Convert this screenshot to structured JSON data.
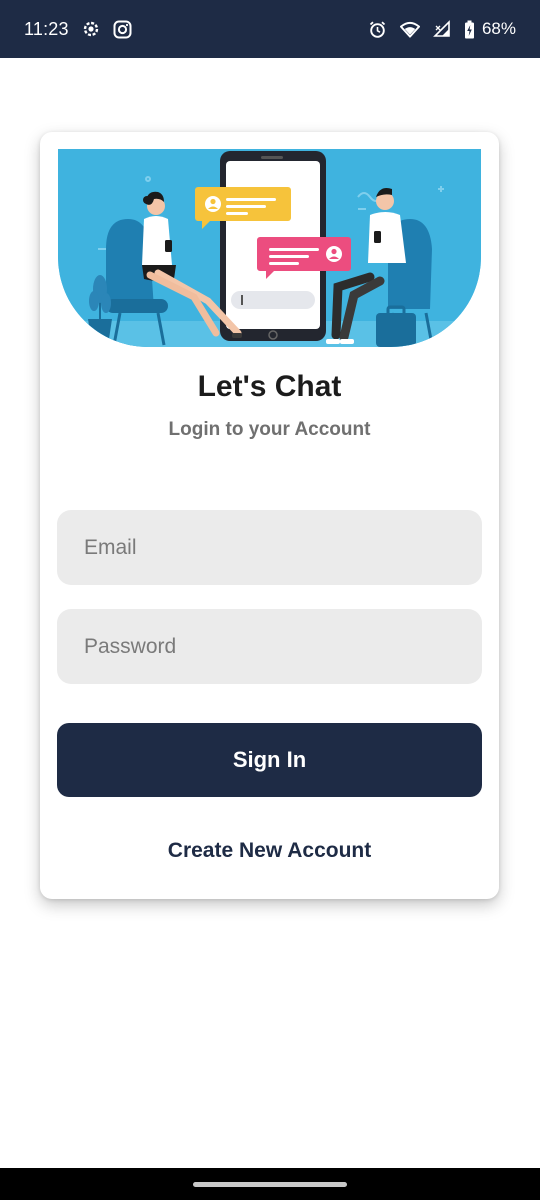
{
  "status_bar": {
    "time": "11:23",
    "battery": "68%",
    "icons": [
      "settings-icon",
      "instagram-icon",
      "alarm-icon",
      "wifi-icon",
      "signal-icon",
      "battery-charging-icon"
    ]
  },
  "login": {
    "title": "Let's Chat",
    "subtitle": "Login to your Account",
    "email_placeholder": "Email",
    "password_placeholder": "Password",
    "sign_in_label": "Sign In",
    "create_account_label": "Create New Account"
  },
  "colors": {
    "primary": "#1e2b45",
    "field_bg": "#ebebeb",
    "hero_bg": "#3fb3df",
    "chat_yellow": "#f6c33b",
    "chat_pink": "#ec4d7f"
  }
}
